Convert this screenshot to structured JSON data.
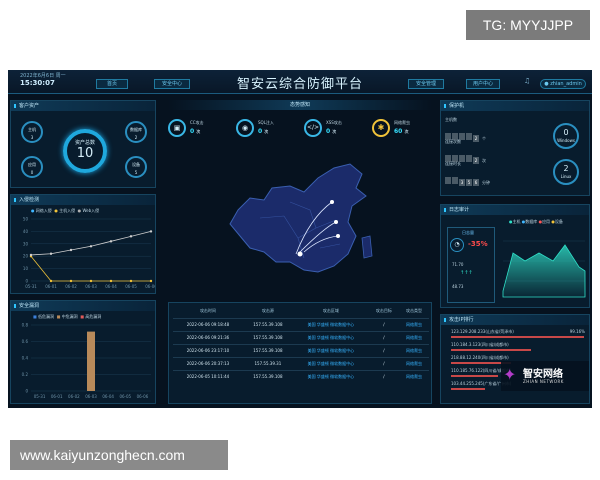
{
  "watermarks": {
    "top": "TG: MYYJJPP",
    "bottom": "www.kaiyunzonghecn.com"
  },
  "header": {
    "date": "2022年6月6日 周一",
    "time": "15:30:07",
    "title": "智安云综合防御平台",
    "nav": [
      "首页",
      "安全中心",
      "安全管理",
      "用户中心"
    ],
    "user": "zhian_admin"
  },
  "assets": {
    "title": "客户资产",
    "total_label": "资产总数",
    "total": "10",
    "items": [
      {
        "label": "主机",
        "value": "3"
      },
      {
        "label": "数据库",
        "value": "2"
      },
      {
        "label": "应用",
        "value": "0"
      },
      {
        "label": "设备",
        "value": "5"
      }
    ]
  },
  "intrusion": {
    "title": "入侵检测",
    "legend": [
      "网络入侵",
      "主机入侵",
      "Web入侵"
    ],
    "colors": [
      "#3fb6ff",
      "#f0c33a",
      "#b0b0b0"
    ]
  },
  "vuln": {
    "title": "安全漏洞",
    "legend": [
      "低危漏洞",
      "中危漏洞",
      "高危漏洞"
    ],
    "colors": [
      "#3b7fd9",
      "#b88a5a",
      "#e05a5a"
    ]
  },
  "attacks": {
    "title": "态势感知",
    "items": [
      {
        "label": "CC攻击",
        "value": "0",
        "unit": "次"
      },
      {
        "label": "SQL注入",
        "value": "0",
        "unit": "次"
      },
      {
        "label": "XSS攻击",
        "value": "0",
        "unit": "次"
      },
      {
        "label": "网络爬虫",
        "value": "60",
        "unit": "次"
      }
    ]
  },
  "table": {
    "headers": [
      "攻击时间",
      "攻击源",
      "攻击区域",
      "攻击目标",
      "攻击类型"
    ],
    "rows": [
      [
        "2022-06-06 09:18:48",
        "157.55.39.108",
        "美国 华盛顿 微软数据中心",
        "/",
        "网络爬虫"
      ],
      [
        "2022-06-06 09:21:36",
        "157.55.39.108",
        "美国 华盛顿 微软数据中心",
        "/",
        "网络爬虫"
      ],
      [
        "2022-06-06 23:17:10",
        "157.55.39.108",
        "美国 华盛顿 微软数据中心",
        "/",
        "网络爬虫"
      ],
      [
        "2022-06-06 20:37:13",
        "157.55.39.31",
        "美国 华盛顿 微软数据中心",
        "/",
        "网络爬虫"
      ],
      [
        "2022-06-05 10:11:44",
        "157.55.39.108",
        "美国 华盛顿 微软数据中心",
        "/",
        "网络爬虫"
      ]
    ]
  },
  "protect": {
    "title": "保护机",
    "rows": [
      {
        "label": "主机数",
        "digits": [
          "",
          "",
          "",
          "",
          "2"
        ],
        "unit": "个"
      },
      {
        "label": "连接次数",
        "digits": [
          "",
          "",
          "",
          "",
          "2"
        ],
        "unit": "次"
      },
      {
        "label": "连接时长",
        "digits": [
          "",
          "",
          "3",
          "5",
          "6"
        ],
        "unit": "分钟"
      }
    ],
    "windows": {
      "value": "0",
      "label": "Windows"
    },
    "linux": {
      "value": "2",
      "label": "Linux"
    }
  },
  "daily": {
    "title": "日志审计",
    "legend": [
      "主机",
      "数据库",
      "应用",
      "设备"
    ],
    "colors": [
      "#2fe0c8",
      "#3fb6ff",
      "#ff5555",
      "#f0c33a"
    ],
    "today_label": "日志量",
    "pct": "-35%",
    "r1": "71.70",
    "r2": "48.73",
    "arrows": "↑↑↑"
  },
  "ipsec": {
    "title": "攻击IP排行",
    "items": [
      {
        "label": "123.129.208.233(山东省/菏泽市)",
        "pct": "99.16%",
        "bar": 0.99
      },
      {
        "label": "110.184.3.123(四川省/成都市)",
        "pct": "",
        "bar": 0.6
      },
      {
        "label": "218.88.12.240(四川省/成都市)",
        "pct": "",
        "bar": 0.45
      },
      {
        "label": "110.185.76.122(四川省/成都市)",
        "pct": "",
        "bar": 0.35
      },
      {
        "label": "103.44.255.245(广东省/广州市)",
        "pct": "",
        "bar": 0.25
      }
    ]
  },
  "brand": {
    "name": "智安网络",
    "sub": "ZHIAN NETWORK"
  },
  "chart_data": [
    {
      "type": "line",
      "title": "入侵检测",
      "x": [
        "05-31",
        "06-01",
        "06-02",
        "06-03",
        "06-04",
        "06-05",
        "06-06"
      ],
      "ylim": [
        0,
        50
      ],
      "yticks": [
        0,
        10,
        20,
        30,
        40,
        50
      ],
      "series": [
        {
          "name": "网络入侵",
          "values": [
            20,
            0,
            0,
            0,
            0,
            0,
            0
          ]
        },
        {
          "name": "主机入侵",
          "values": [
            21,
            22,
            25,
            28,
            32,
            36,
            40
          ]
        }
      ]
    },
    {
      "type": "bar",
      "title": "安全漏洞",
      "categories": [
        "05-31",
        "06-01",
        "06-02",
        "06-03",
        "06-04",
        "06-05",
        "06-06"
      ],
      "ylim": [
        0,
        0.8
      ],
      "yticks": [
        0,
        0.2,
        0.4,
        0.6,
        0.8
      ],
      "series": [
        {
          "name": "中危漏洞",
          "values": [
            0,
            0,
            0,
            0.72,
            0,
            0,
            0
          ]
        }
      ]
    }
  ]
}
